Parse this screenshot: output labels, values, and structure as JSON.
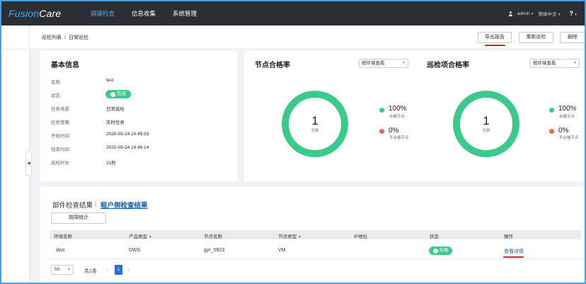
{
  "app": {
    "logo_prefix": "Fusion",
    "logo_suffix": "Care"
  },
  "nav": {
    "items": [
      "健康检查",
      "信息收集",
      "系统管理"
    ],
    "active": 0
  },
  "top_right": {
    "user": "admin",
    "language": "简体中文",
    "help": "?"
  },
  "breadcrumb": {
    "parent": "巡检列表",
    "separator": "/",
    "current": "日常巡检"
  },
  "actions": {
    "export": "导出报告",
    "recheck": "重新巡检",
    "delete": "删除"
  },
  "basic_info": {
    "title": "基本信息",
    "rows": [
      {
        "label": "名称",
        "value": "test"
      },
      {
        "label": "状态",
        "value": "完成"
      },
      {
        "label": "任务场景",
        "value": "日常巡检"
      },
      {
        "label": "任务策略",
        "value": "实时任务"
      },
      {
        "label": "开始时间",
        "value": "2020-09-24 14:45:53"
      },
      {
        "label": "结束时间",
        "value": "2020-09-24 14:46:14"
      },
      {
        "label": "巡检时长",
        "value": "21秒"
      }
    ]
  },
  "node_rate": {
    "title": "节点合格率",
    "filter": "按环境查看",
    "total_count": "1",
    "total_label": "总数",
    "legend": [
      {
        "pct": "100%",
        "name": "合格节点",
        "color": "#3dc98b"
      },
      {
        "pct": "0%",
        "name": "不合格节点",
        "color": "#f0625a"
      }
    ]
  },
  "item_rate": {
    "title": "巡检项合格率",
    "filter": "按环境查看",
    "total_count": "1",
    "total_label": "总数",
    "legend": [
      {
        "pct": "100%",
        "name": "合格节点",
        "color": "#3dc98b"
      },
      {
        "pct": "0%",
        "name": "不合格节点",
        "color": "#f0625a"
      }
    ]
  },
  "results": {
    "tab_components": "部件检查结果",
    "tab_sep": "|",
    "tab_tenant": "租户侧检查结果",
    "fault_stats": "故障统计",
    "columns": [
      "环境名称",
      "产品类型",
      "节点名称",
      "节点类型",
      "IP地址",
      "状态",
      "操作"
    ],
    "rows": [
      {
        "env": "dws",
        "product": "DWS",
        "node": "gyr_0923",
        "node_type": "VM",
        "ip": "",
        "status": "合格",
        "action": "查看详情"
      }
    ],
    "page_size": "50",
    "total": "共1条",
    "page": "1"
  },
  "colors": {
    "accent": "#3fa7f5",
    "green": "#3dc98b",
    "red": "#f0625a",
    "link": "#1a5fa8",
    "nav_bg": "#2c2e33"
  }
}
